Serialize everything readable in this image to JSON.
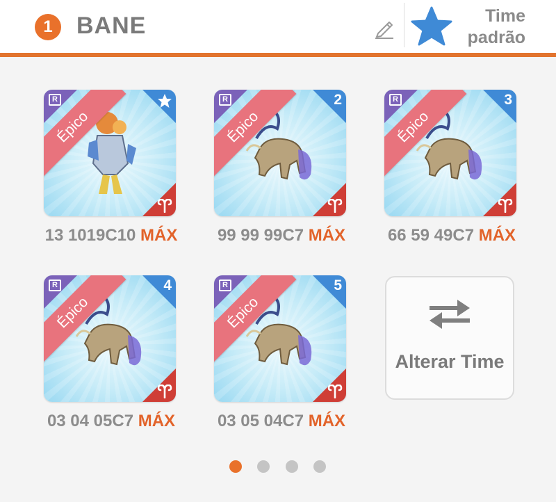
{
  "header": {
    "team_number": "1",
    "team_name": "BANE",
    "default_label": [
      "Time",
      "padrão"
    ],
    "star_color": "#3f8ad6",
    "accent_color": "#e2742e"
  },
  "slots": [
    {
      "rarity_label": "Épico",
      "marker": "star-icon",
      "levels": "13 1019C10",
      "max_label": "MÁX",
      "monster": "armored-mage"
    },
    {
      "rarity_label": "Épico",
      "marker": "2",
      "levels": "99 99 99C7",
      "max_label": "MÁX",
      "monster": "skeletal-beast"
    },
    {
      "rarity_label": "Épico",
      "marker": "3",
      "levels": "66 59 49C7",
      "max_label": "MÁX",
      "monster": "skeletal-beast"
    },
    {
      "rarity_label": "Épico",
      "marker": "4",
      "levels": "03 04 05C7",
      "max_label": "MÁX",
      "monster": "skeletal-beast"
    },
    {
      "rarity_label": "Épico",
      "marker": "5",
      "levels": "03 05 04C7",
      "max_label": "MÁX",
      "monster": "skeletal-beast"
    }
  ],
  "switch_button": {
    "label": "Alterar Time",
    "icon": "swap-arrows-icon"
  },
  "pagination": {
    "pages": 4,
    "current": 1,
    "active_color": "#e9712b"
  }
}
